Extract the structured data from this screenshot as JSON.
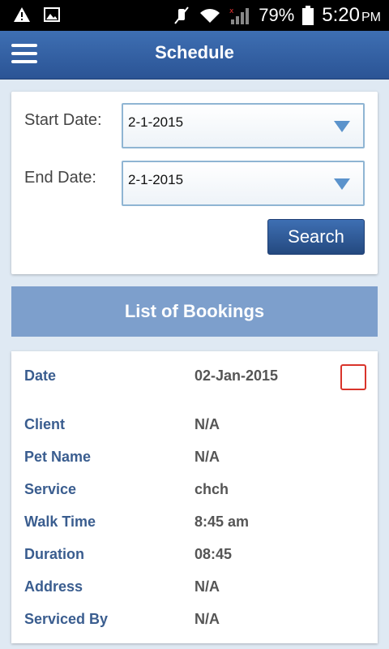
{
  "status_bar": {
    "icons": [
      "warning-icon",
      "image-icon",
      "mute-icon",
      "wifi-icon",
      "signal-icon",
      "battery-icon"
    ],
    "battery": "79%",
    "time": "5:20",
    "ampm": "PM"
  },
  "app_bar": {
    "title": "Schedule"
  },
  "filters": {
    "start_label": "Start Date:",
    "start_value": "2-1-2015",
    "end_label": "End Date:",
    "end_value": "2-1-2015",
    "search_label": "Search"
  },
  "list": {
    "header": "List of Bookings"
  },
  "booking": {
    "date_label": "Date",
    "date_value": "02-Jan-2015",
    "client_label": "Client",
    "client_value": "N/A",
    "pet_label": "Pet Name",
    "pet_value": "N/A",
    "service_label": "Service",
    "service_value": "chch",
    "walk_label": "Walk Time",
    "walk_value": "8:45 am",
    "duration_label": "Duration",
    "duration_value": "08:45",
    "address_label": "Address",
    "address_value": "N/A",
    "serviced_label": "Serviced By",
    "serviced_value": "N/A",
    "selected": false
  },
  "colors": {
    "app_bar": "#2f5c9e",
    "list_header": "#7d9fcc",
    "checkbox_border": "#d9342b",
    "label": "#3a5d8f"
  }
}
